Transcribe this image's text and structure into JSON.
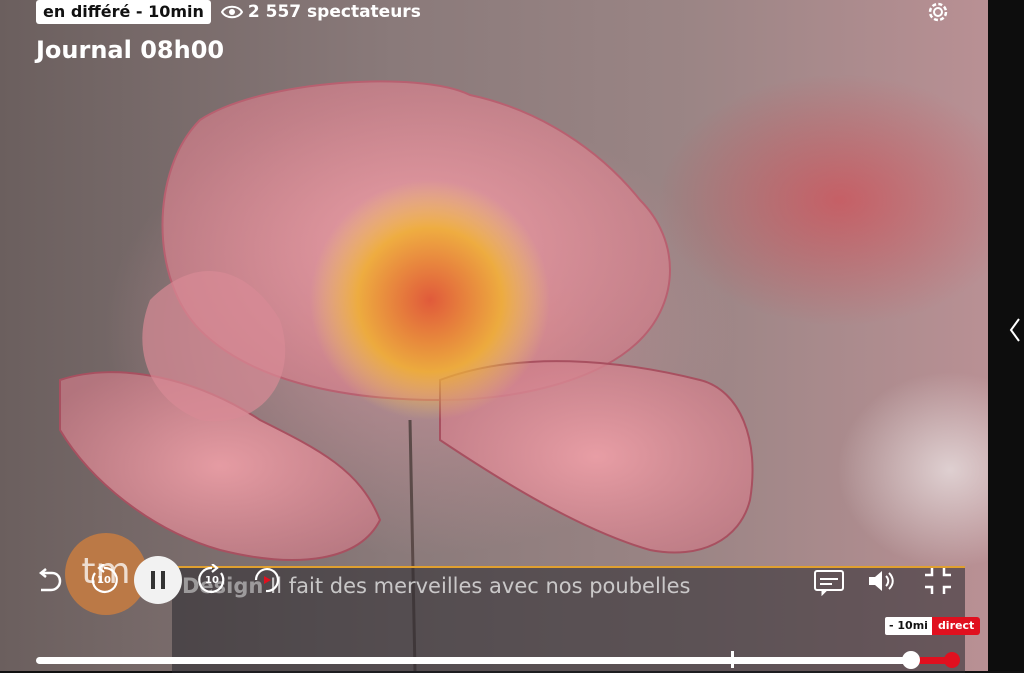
{
  "header": {
    "badge": "en différé - 10min",
    "viewers": "2 557 spectateurs",
    "title": "Journal 08h00"
  },
  "subtitle": {
    "prefix": "Design",
    "text": "Il fait des merveilles avec nos poubelles"
  },
  "logo": {
    "text": "tm"
  },
  "controls": {
    "rewind_label": "10",
    "forward_label": "10",
    "state": "playing"
  },
  "time": {
    "delay": "- 10mi",
    "live": "direct"
  },
  "icons": {
    "viewers": "eye-icon",
    "settings": "gear-icon",
    "back": "undo-icon",
    "rewind": "rewind-10-icon",
    "pause": "pause-icon",
    "forward": "forward-10-icon",
    "restart": "restart-icon",
    "subtitles": "subtitles-icon",
    "volume": "volume-icon",
    "exit_fullscreen": "exit-fullscreen-icon",
    "side_panel": "chevron-left-icon"
  },
  "colors": {
    "accent": "#e0101f",
    "subtitle_line": "#e0a030"
  },
  "progress": {
    "position_fraction": 0.955,
    "buffer_marker_fraction": 0.758
  }
}
